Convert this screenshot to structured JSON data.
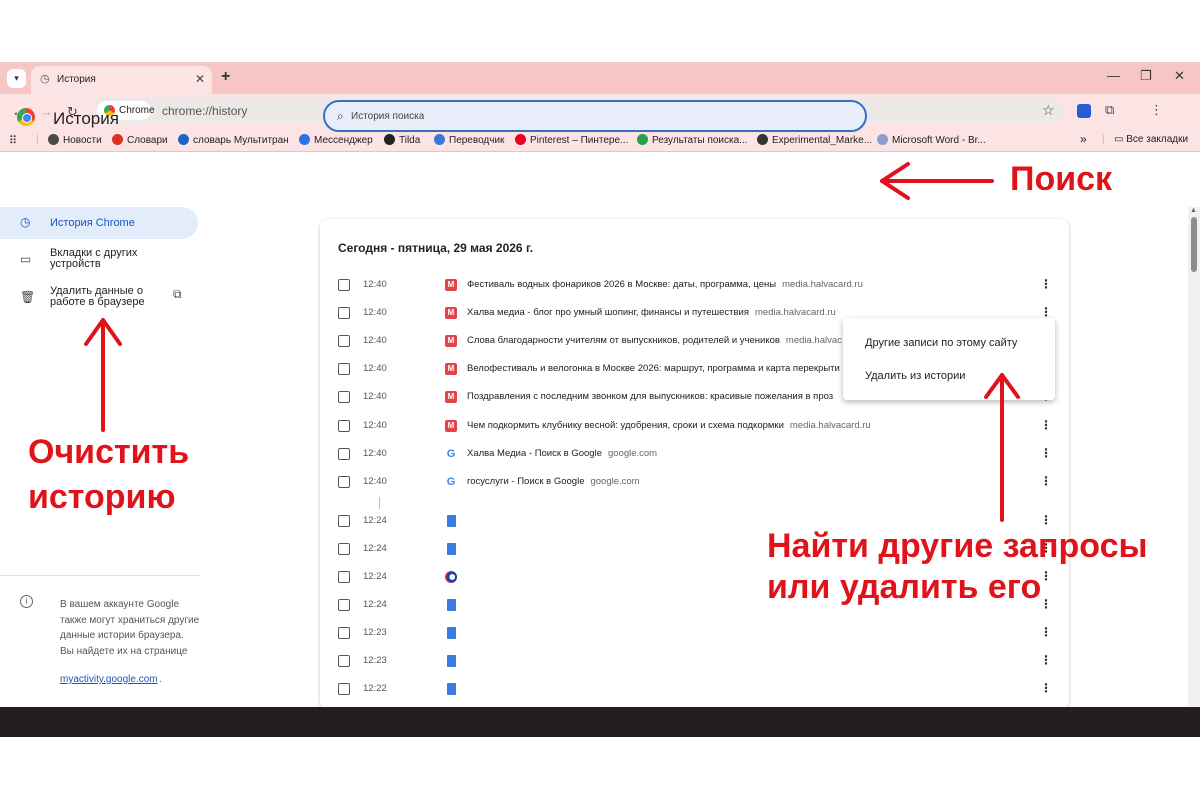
{
  "tab": {
    "title": "История",
    "close": "✕",
    "new_tab": "+"
  },
  "window": {
    "minimize": "—",
    "maximize": "❐",
    "close": "✕"
  },
  "toolbar": {
    "back": "←",
    "forward": "→",
    "reload": "↻",
    "chip_label": "Chrome",
    "url": "chrome://history",
    "star": "☆",
    "menu": "⋮"
  },
  "bookmarks": {
    "items": [
      {
        "label": "Новости",
        "color": "#4a4a4a"
      },
      {
        "label": "Словари",
        "color": "#e0301e"
      },
      {
        "label": "словарь Мультитран",
        "color": "#1c64c8"
      },
      {
        "label": "Мессенджер",
        "color": "#2a72e8"
      },
      {
        "label": "Tilda",
        "color": "#222222"
      },
      {
        "label": "Переводчик",
        "color": "#3a78d8"
      },
      {
        "label": "Pinterest – Пинтере...",
        "color": "#e60023"
      },
      {
        "label": "Результаты поиска...",
        "color": "#2b9e4a"
      },
      {
        "label": "Experimental_Marke...",
        "color": "#333333"
      },
      {
        "label": "Microsoft Word - Br...",
        "color": "#8aa0c8"
      }
    ],
    "more": "»",
    "all": "Все закладки"
  },
  "sidebar": {
    "title": "История",
    "items": [
      {
        "label": "История Chrome"
      },
      {
        "label_line1": "Вкладки с других",
        "label_line2": "устройств"
      },
      {
        "label_line1": "Удалить данные о",
        "label_line2": "работе в браузере"
      }
    ],
    "info_text": "В вашем аккаунте Google также могут храниться другие данные истории браузера. Вы найдете их на странице",
    "info_link": "myactivity.google.com",
    "info_dot": "."
  },
  "search": {
    "placeholder": "История поиска"
  },
  "history": {
    "day_heading": "Сегодня - пятница, 29 мая 2026 г.",
    "rows": [
      {
        "time": "12:40",
        "icon": "m",
        "title": "Фестиваль водных фонариков 2026 в Москве: даты, программа, цены",
        "domain": "media.halvacard.ru"
      },
      {
        "time": "12:40",
        "icon": "m",
        "title": "Халва медиа - блог про умный шопинг, финансы и путешествия",
        "domain": "media.halvacard.ru"
      },
      {
        "time": "12:40",
        "icon": "m",
        "title": "Слова благодарности учителям от выпускников, родителей и учеников",
        "domain": "media.halvac"
      },
      {
        "time": "12:40",
        "icon": "m",
        "title": "Велофестиваль и велогонка в Москве 2026: маршрут, программа и карта перекрыти",
        "domain": ""
      },
      {
        "time": "12:40",
        "icon": "m",
        "title": "Поздравления с последним звонком для выпускников: красивые пожелания в проз",
        "domain": ""
      },
      {
        "time": "12:40",
        "icon": "m",
        "title": "Чем подкормить клубнику весной: удобрения, сроки и схема подкормки",
        "domain": "media.halvacard.ru"
      },
      {
        "time": "12:40",
        "icon": "g",
        "title": "Халва Медиа - Поиск в Google",
        "domain": "google.com"
      },
      {
        "time": "12:40",
        "icon": "g",
        "title": "госуслуги - Поиск в Google",
        "domain": "google.com"
      },
      {
        "time": "12:24",
        "icon": "d",
        "title": "",
        "domain": ""
      },
      {
        "time": "12:24",
        "icon": "d",
        "title": "",
        "domain": ""
      },
      {
        "time": "12:24",
        "icon": "c",
        "title": "",
        "domain": ""
      },
      {
        "time": "12:24",
        "icon": "d",
        "title": "",
        "domain": ""
      },
      {
        "time": "12:23",
        "icon": "d",
        "title": "",
        "domain": ""
      },
      {
        "time": "12:23",
        "icon": "d",
        "title": "",
        "domain": ""
      },
      {
        "time": "12:22",
        "icon": "d",
        "title": "",
        "domain": ""
      }
    ]
  },
  "context_menu": {
    "item1": "Другие записи по этому сайту",
    "item2": "Удалить из истории"
  },
  "annotations": {
    "search": "Поиск",
    "clear_line1": "Очистить",
    "clear_line2": "историю",
    "find_line1": "Найти другие запросы",
    "find_line2": "или удалить его",
    "color": "#e0131b"
  },
  "colors": {
    "tabstrip": "#f6c6c4",
    "toolbar": "#fbe4e3",
    "accent": "#1a56c4",
    "taskbar": "#221e1f"
  }
}
